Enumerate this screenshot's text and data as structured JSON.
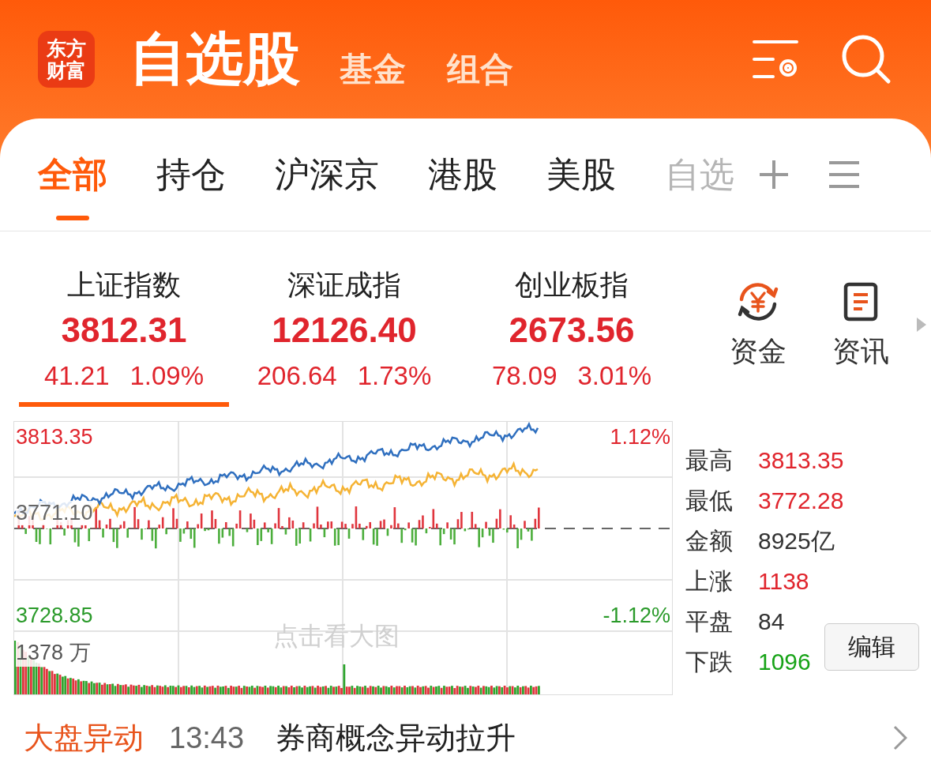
{
  "header": {
    "logo": [
      "东方",
      "财富"
    ],
    "title": "自选股",
    "links": [
      "基金",
      "组合"
    ]
  },
  "tabs": [
    {
      "label": "全部",
      "selected": true
    },
    {
      "label": "持仓",
      "selected": false
    },
    {
      "label": "沪深京",
      "selected": false
    },
    {
      "label": "港股",
      "selected": false
    },
    {
      "label": "美股",
      "selected": false
    },
    {
      "label": "自选",
      "selected": false
    }
  ],
  "indices": [
    {
      "name": "上证指数",
      "value": "3812.31",
      "change": "41.21",
      "percent": "1.09%",
      "selected": true
    },
    {
      "name": "深证成指",
      "value": "12126.40",
      "change": "206.64",
      "percent": "1.73%",
      "selected": false
    },
    {
      "name": "创业板指",
      "value": "2673.56",
      "change": "78.09",
      "percent": "3.01%",
      "selected": false
    }
  ],
  "shortcuts": [
    {
      "kind": "funds",
      "label": "资金"
    },
    {
      "kind": "news",
      "label": "资讯"
    }
  ],
  "chart": {
    "high_label": "3813.35",
    "base_label": "3771.10",
    "low_label": "3728.85",
    "high_pct": "1.12%",
    "low_pct": "-1.12%",
    "volume_label": "1378 万",
    "watermark": "点击看大图"
  },
  "stats": [
    {
      "label": "最高",
      "value": "3813.35",
      "color": "#e0252d"
    },
    {
      "label": "最低",
      "value": "3772.28",
      "color": "#e0252d"
    },
    {
      "label": "金额",
      "value": "8925亿",
      "color": "#333333"
    },
    {
      "label": "上涨",
      "value": "1138",
      "color": "#e0252d"
    },
    {
      "label": "平盘",
      "value": "84",
      "color": "#333333"
    },
    {
      "label": "下跌",
      "value": "1096",
      "color": "#17a317"
    }
  ],
  "edit_button": "编辑",
  "news": {
    "tag": "大盘异动",
    "time": "13:43",
    "headline": "券商概念异动拉升"
  }
}
